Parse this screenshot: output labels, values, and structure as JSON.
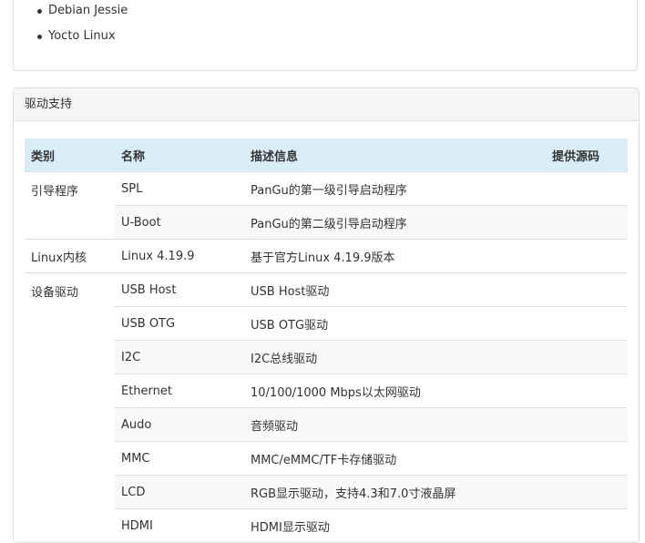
{
  "os_list": [
    "Debian Jessie",
    "Yocto Linux"
  ],
  "driver_panel": {
    "title": "驱动支持",
    "headers": {
      "category": "类别",
      "name": "名称",
      "description": "描述信息",
      "source": "提供源码"
    },
    "rows": [
      {
        "category": "引导程序",
        "name": "SPL",
        "description": "PanGu的第一级引导启动程序"
      },
      {
        "name": "U-Boot",
        "description": "PanGu的第二级引导启动程序"
      },
      {
        "category": "Linux内核",
        "name": "Linux 4.19.9",
        "description": "基于官方Linux 4.19.9版本"
      },
      {
        "category": "设备驱动",
        "name": "USB Host",
        "description": "USB Host驱动"
      },
      {
        "name": "USB OTG",
        "description": "USB OTG驱动"
      },
      {
        "name": "I2C",
        "description": "I2C总线驱动"
      },
      {
        "name": "Ethernet",
        "description": "10/100/1000 Mbps以太网驱动"
      },
      {
        "name": "Audo",
        "description": "音频驱动"
      },
      {
        "name": "MMC",
        "description": "MMC/eMMC/TF卡存储驱动"
      },
      {
        "name": "LCD",
        "description": "RGB显示驱动，支持4.3和7.0寸液晶屏"
      },
      {
        "name": "HDMI",
        "description": "HDMI显示驱动"
      }
    ]
  }
}
